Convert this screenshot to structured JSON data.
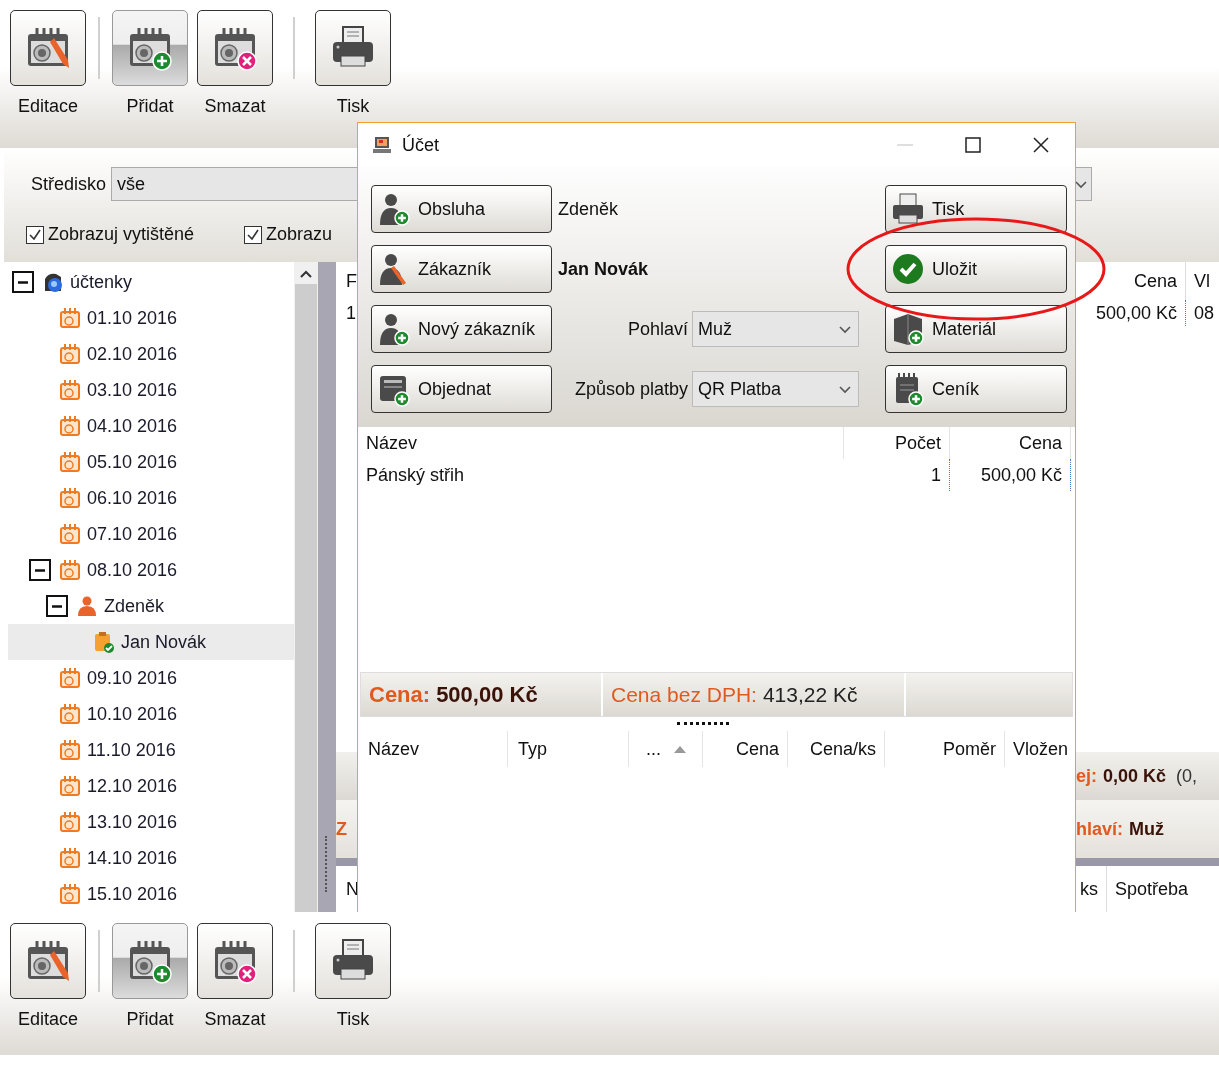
{
  "toolbar_top": {
    "buttons": [
      {
        "label": "Editace",
        "pressed": false
      },
      {
        "label": "Přidat",
        "pressed": true
      },
      {
        "label": "Smazat",
        "pressed": false
      },
      {
        "label": "Tisk",
        "pressed": false
      }
    ]
  },
  "filter": {
    "center_label": "Středisko",
    "center_value": "vše",
    "checkboxes": [
      {
        "label": "Zobrazuj vytištěné",
        "checked": true
      },
      {
        "label": "Zobrazu",
        "checked": true
      }
    ]
  },
  "tree": [
    {
      "label": "účtenky",
      "kind": "root",
      "expanded": true,
      "selected": false,
      "children": [
        {
          "label": "01.10 2016",
          "kind": "date",
          "selected": false
        },
        {
          "label": "02.10 2016",
          "kind": "date",
          "selected": false
        },
        {
          "label": "03.10 2016",
          "kind": "date",
          "selected": false
        },
        {
          "label": "04.10 2016",
          "kind": "date",
          "selected": false
        },
        {
          "label": "05.10 2016",
          "kind": "date",
          "selected": false
        },
        {
          "label": "06.10 2016",
          "kind": "date",
          "selected": false
        },
        {
          "label": "07.10 2016",
          "kind": "date",
          "selected": false
        },
        {
          "label": "08.10 2016",
          "kind": "date",
          "expanded": true,
          "selected": false,
          "children": [
            {
              "label": "Zdeněk",
              "kind": "person",
              "expanded": true,
              "selected": false,
              "children": [
                {
                  "label": "Jan Novák",
                  "kind": "receipt",
                  "selected": true
                }
              ]
            }
          ]
        },
        {
          "label": "09.10 2016",
          "kind": "date",
          "selected": false
        },
        {
          "label": "10.10 2016",
          "kind": "date",
          "selected": false
        },
        {
          "label": "11.10 2016",
          "kind": "date",
          "selected": false
        },
        {
          "label": "12.10 2016",
          "kind": "date",
          "selected": false
        },
        {
          "label": "13.10 2016",
          "kind": "date",
          "selected": false
        },
        {
          "label": "14.10 2016",
          "kind": "date",
          "selected": false
        },
        {
          "label": "15.10 2016",
          "kind": "date",
          "selected": false
        }
      ]
    }
  ],
  "behind_table": {
    "header_start": "F",
    "header_end": [
      "Cena",
      "Vl"
    ],
    "row_start": "1",
    "row_end": [
      "500,00 Kč",
      "08"
    ]
  },
  "behind_summary": {
    "label": "ej:",
    "value": "0,00 Kč",
    "extra": "(0,",
    "line2_start": "Z",
    "line2_label": "hlaví:",
    "line2_value": "Muž"
  },
  "behind_table2": {
    "start": "N",
    "end": [
      "ks",
      "Spotřeba"
    ]
  },
  "dialog": {
    "title": "Účet",
    "window_controls": [
      {
        "kind": "minimize",
        "disabled": true
      },
      {
        "kind": "maximize",
        "disabled": false
      },
      {
        "kind": "close",
        "disabled": false
      }
    ],
    "left_buttons": [
      {
        "label": "Obsluha"
      },
      {
        "label": "Zákazník"
      },
      {
        "label": "Nový zákazník"
      },
      {
        "label": "Objednat"
      }
    ],
    "right_buttons": [
      {
        "label": "Tisk",
        "circled": false
      },
      {
        "label": "Uložit",
        "circled": true
      },
      {
        "label": "Materiál",
        "circled": false
      },
      {
        "label": "Ceník",
        "circled": false
      }
    ],
    "staff": "Zdeněk",
    "customer": "Jan Novák",
    "gender": {
      "label": "Pohlaví",
      "value": "Muž"
    },
    "payment": {
      "label": "Způsob platby",
      "value": "QR Platba"
    },
    "items_table": {
      "columns": [
        "Název",
        "Počet",
        "Cena"
      ],
      "rows": [
        [
          "Pánský střih",
          "1",
          "500,00 Kč"
        ]
      ]
    },
    "totals": {
      "price_label": "Cena:",
      "price": "500,00 Kč",
      "net_label": "Cena bez DPH:",
      "net": "413,22 Kč"
    },
    "materials_table": {
      "columns": [
        {
          "label": "Název",
          "sorted": false
        },
        {
          "label": "Typ",
          "sorted": false
        },
        {
          "label": "...",
          "sorted": true
        },
        {
          "label": "Cena",
          "sorted": false
        },
        {
          "label": "Cena/ks",
          "sorted": false
        },
        {
          "label": "Poměr",
          "sorted": false
        },
        {
          "label": "Vložen",
          "sorted": false
        }
      ]
    }
  },
  "toolbar_bottom": {
    "buttons": [
      {
        "label": "Editace",
        "pressed": false
      },
      {
        "label": "Přidat",
        "pressed": true
      },
      {
        "label": "Smazat",
        "pressed": false
      },
      {
        "label": "Tisk",
        "pressed": false
      }
    ]
  }
}
